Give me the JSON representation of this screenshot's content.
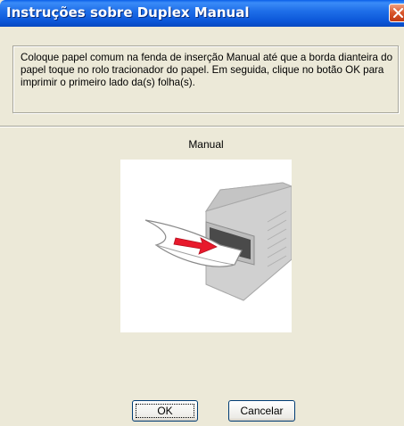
{
  "window": {
    "title": "Instruções sobre Duplex Manual"
  },
  "message": {
    "text": "Coloque papel comum na fenda de inserção Manual até que a borda dianteira do papel toque no rolo tracionador do papel. Em seguida, clique no botão OK para imprimir o primeiro lado da(s) folha(s)."
  },
  "illustration": {
    "caption": "Manual",
    "arrow_color": "#e8192c"
  },
  "buttons": {
    "ok_label": "OK",
    "cancel_label": "Cancelar"
  },
  "colors": {
    "titlebar": "#0b56d8",
    "dialog_bg": "#ece9d8",
    "close_button": "#d8552a"
  }
}
